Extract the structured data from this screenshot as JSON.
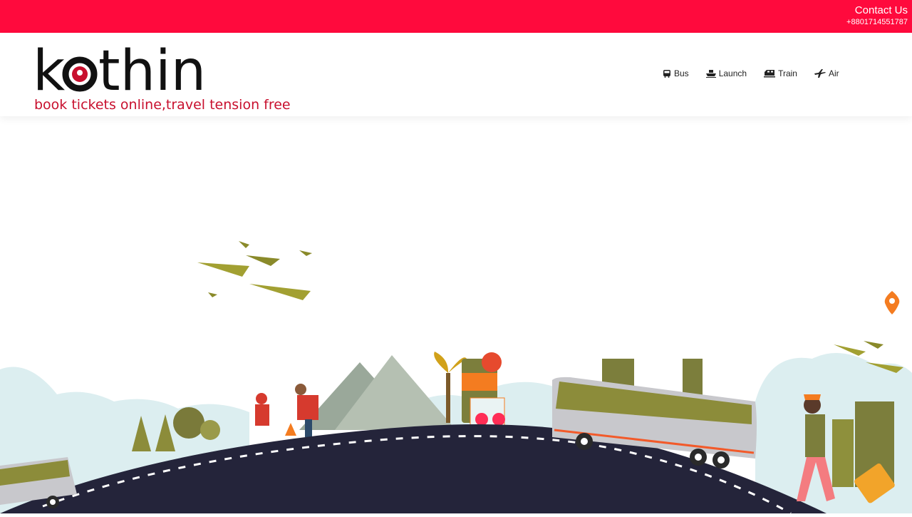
{
  "topbar": {
    "contact_title": "Contact Us",
    "contact_phone": "+8801714551787",
    "accent": "#ff0a3d"
  },
  "logo": {
    "word": "kothin",
    "tagline": "book tickets online,travel tension free",
    "brand_color": "#c8102e"
  },
  "nav": {
    "items": [
      {
        "label": "Bus",
        "icon": "bus-icon"
      },
      {
        "label": "Launch",
        "icon": "launch-icon"
      },
      {
        "label": "Train",
        "icon": "train-icon"
      },
      {
        "label": "Air",
        "icon": "plane-icon"
      }
    ]
  }
}
